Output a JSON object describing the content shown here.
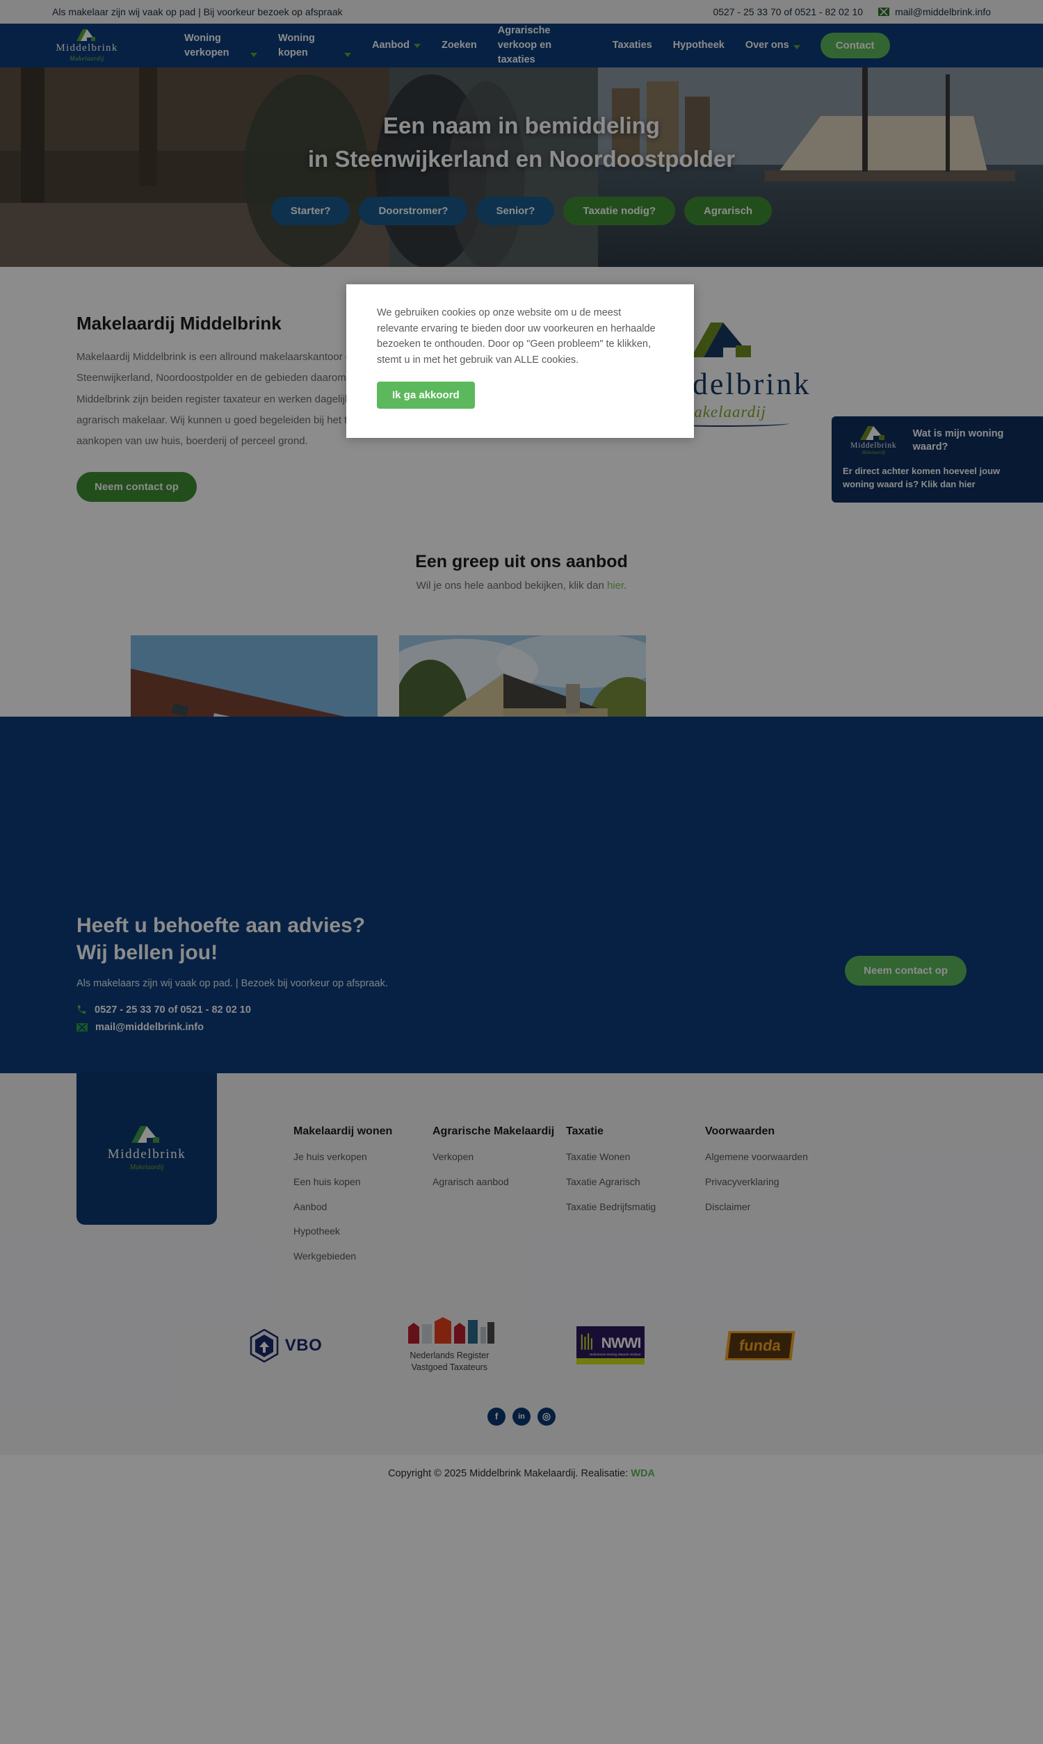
{
  "topbar": {
    "tagline": "Als makelaar zijn wij vaak op pad | Bij voorkeur bezoek op afspraak",
    "phone": "0527 - 25 33 70 of 0521 - 82 02 10",
    "email": "mail@middelbrink.info"
  },
  "brand": {
    "name": "Middelbrink",
    "tagline": "Makelaardij"
  },
  "nav": {
    "items": [
      {
        "label": "Woning verkopen",
        "has_dropdown": true
      },
      {
        "label": "Woning kopen",
        "has_dropdown": true
      },
      {
        "label": "Aanbod",
        "has_dropdown": true
      },
      {
        "label": "Zoeken",
        "has_dropdown": false
      },
      {
        "label": "Agrarische verkoop en taxaties",
        "has_dropdown": false
      },
      {
        "label": "Taxaties",
        "has_dropdown": false
      },
      {
        "label": "Hypotheek",
        "has_dropdown": false
      },
      {
        "label": "Over ons",
        "has_dropdown": true
      }
    ],
    "contact_button": "Contact"
  },
  "hero": {
    "title_line1": "Een naam in bemiddeling",
    "title_line2": "in Steenwijkerland en Noordoostpolder",
    "buttons": [
      {
        "label": "Starter?",
        "color": "blue"
      },
      {
        "label": "Doorstromer?",
        "color": "blue"
      },
      {
        "label": "Senior?",
        "color": "blue"
      },
      {
        "label": "Taxatie nodig?",
        "color": "green"
      },
      {
        "label": "Agrarisch",
        "color": "green"
      }
    ]
  },
  "cookie": {
    "text": "We gebruiken cookies op onze website om u de meest relevante ervaring te bieden door uw voorkeuren en herhaalde bezoeken te onthouden. Door op \"Geen probleem\" te klikken, stemt u in met het gebruik van ALLE cookies.",
    "accept_label": "Ik ga akkoord"
  },
  "about": {
    "heading": "Makelaardij Middelbrink",
    "body": "Makelaardij Middelbrink is een allround makelaarskantoor dat werkzaam is in de regio's Steenwijkerland, Noordoostpolder en de gebieden daarom heen. Gerard en Agnes Middelbrink zijn beiden register taxateur en werken dagelijks als woonmakelaar en agrarisch makelaar. Wij kunnen u goed begeleiden bij het taxeren, verkopen of aankopen van uw huis, boerderij of perceel grond.",
    "cta_label": "Neem contact op"
  },
  "value_widget": {
    "brand": "Middelbrink",
    "brand_sub": "Makelaardij",
    "title": "Wat is mijn woning waard?",
    "body": "Er direct achter komen hoeveel jouw woning waard is? Klik dan hier"
  },
  "aanbod": {
    "heading": "Een greep uit ons aanbod",
    "sub_before": "Wil je ons hele aanbod bekijken, klik dan ",
    "sub_link": "hier",
    "sub_after": ".",
    "cards": [
      {
        "alt": "Rijtjeswoning met bruine dakpannen aan een klinkerstraat"
      },
      {
        "alt": "Vrijstaande gele bakstenen woning met tuin"
      }
    ]
  },
  "cta": {
    "heading_line1": "Heeft u behoefte aan advies?",
    "heading_line2": "Wij bellen jou!",
    "sub": "Als makelaars zijn wij vaak op pad. | Bezoek bij voorkeur op afspraak.",
    "phone": "0527 - 25 33 70 of 0521 - 82 02 10",
    "email": "mail@middelbrink.info",
    "button": "Neem contact op"
  },
  "footer": {
    "brand": "Middelbrink",
    "brand_sub": "Makelaardij",
    "columns": [
      {
        "title": "Makelaardij wonen",
        "links": [
          "Je huis verkopen",
          "Een huis kopen",
          "Aanbod",
          "Hypotheek",
          "Werkgebieden"
        ]
      },
      {
        "title": "Agrarische Makelaardij",
        "links": [
          "Verkopen",
          "Agrarisch aanbod"
        ]
      },
      {
        "title": "Taxatie",
        "links": [
          "Taxatie Wonen",
          "Taxatie Agrarisch",
          "Taxatie Bedrijfsmatig"
        ]
      },
      {
        "title": "Voorwaarden",
        "links": [
          "Algemene voorwaarden",
          "Privacyverklaring",
          "Disclaimer"
        ]
      }
    ],
    "partners": [
      {
        "name": "VBO"
      },
      {
        "name": "Nederlands Register Vastgoed Taxateurs",
        "line1": "Nederlands Register",
        "line2": "Vastgoed Taxateurs"
      },
      {
        "name": "NWWI",
        "sub": "Nederlands Woning Waarde Instituut"
      },
      {
        "name": "funda"
      }
    ],
    "socials": [
      {
        "name": "facebook",
        "glyph": "f"
      },
      {
        "name": "linkedin",
        "glyph": "in"
      },
      {
        "name": "instagram",
        "glyph": "◎"
      }
    ],
    "copyright_text": "Copyright © 2025 Middelbrink Makelaardij. Realisatie: ",
    "copyright_link": "WDA"
  }
}
